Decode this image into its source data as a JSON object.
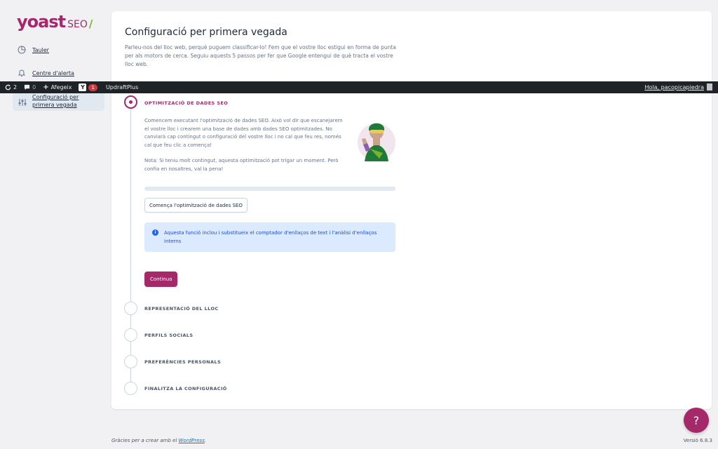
{
  "logo": {
    "brand": "yoast",
    "product": "SEO",
    "slash": "/"
  },
  "sidebar": {
    "items": [
      {
        "label": "Tauler",
        "icon": "dashboard-icon"
      },
      {
        "label": "Centre d'alerta",
        "icon": "bell-icon"
      },
      {
        "label": "Configuració per primera vegada",
        "icon": "adjustments-icon",
        "active": true
      }
    ]
  },
  "adminbar": {
    "updates_count": "2",
    "comments_count": "0",
    "add_new": "Afegeix",
    "yoast_badge": "1",
    "updraft": "UpdraftPlus",
    "greeting": "Hola, pacopicapiedra"
  },
  "main": {
    "title": "Configuració per primera vegada",
    "intro": "Parleu-nos del lloc web, perquè puguem classificar-lo! Fem que el vostre lloc estigui en forma de punta per als motors de cerca. Seguiu aquests 5 passos per fer que Google entengui de què tracta el vostre lloc web."
  },
  "steps": [
    {
      "label": "OPTIMITZACIÓ DE DADES SEO",
      "active": true
    },
    {
      "label": "REPRESENTACIÓ DEL LLOC",
      "active": false
    },
    {
      "label": "PERFILS SOCIALS",
      "active": false
    },
    {
      "label": "PREFERÈNCIES PERSONALS",
      "active": false
    },
    {
      "label": "FINALITZA LA CONFIGURACIÓ",
      "active": false
    }
  ],
  "seo_step": {
    "description": "Comencem executant l'optimització de dades SEO. Això vol dir que escanejarem el vostre lloc i crearem una base de dades amb dades SEO optimitzades. No canviarà cap contingut o configuració del vostre lloc i no cal que feu res, només cal que feu clic a comença!",
    "note": "Nota: Si teniu molt contingut, aquesta optimització pot trigar un moment. Però confia en nosaltres, val la pena!",
    "progress": 0,
    "start_button": "Comença l'optimització de dades SEO",
    "notice": "Aquesta funció inclou i substitueix el comptador d'enllaços de text i l'anàlisi d'enllaços interns",
    "continue_button": "Continua"
  },
  "footer": {
    "thanks_prefix": "Gràcies per a crear amb el ",
    "thanks_link": "WordPress",
    "thanks_suffix": ".",
    "version": "Versió 6.8.3"
  },
  "help": {
    "label": "?"
  },
  "colors": {
    "accent": "#a4286a",
    "green": "#77b227",
    "notice_bg": "#dbeafe",
    "notice_text": "#1d4ed8"
  }
}
